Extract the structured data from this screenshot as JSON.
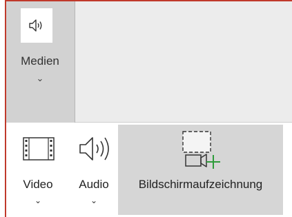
{
  "ribbon": {
    "group": {
      "label": "Medien",
      "icon": "speaker-icon",
      "chevron": "⌄"
    },
    "dropdown": {
      "items": [
        {
          "label": "Video",
          "icon": "film-icon",
          "chevron": "⌄"
        },
        {
          "label": "Audio",
          "icon": "speaker-icon",
          "chevron": "⌄"
        },
        {
          "label": "Bildschirmaufzeichnung",
          "icon": "screen-recording-icon"
        }
      ]
    }
  },
  "colors": {
    "accent_border": "#c0392b",
    "ribbon_bg": "#ececec",
    "pressed_bg": "#d2d2d2",
    "hover_bg": "#d6d6d6",
    "plus_green": "#2e9b3a"
  }
}
